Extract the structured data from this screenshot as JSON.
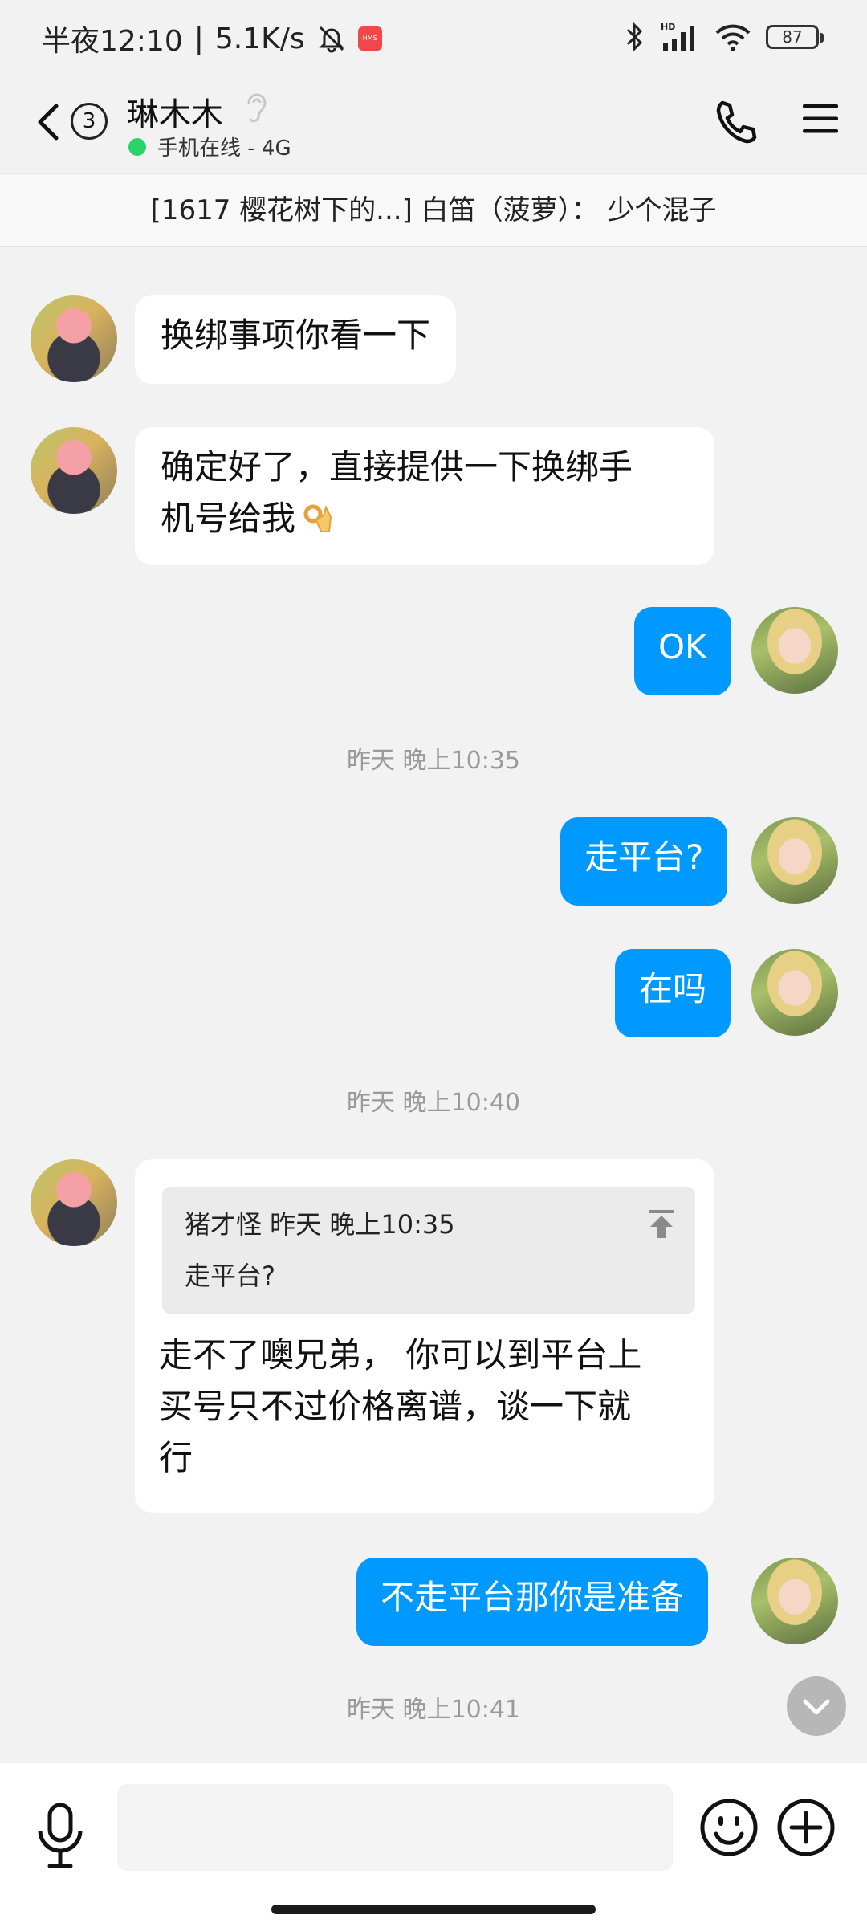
{
  "status_bar": {
    "time": "半夜12:10",
    "net_speed": "5.1K/s",
    "hms_label": "HMS",
    "hd_label": "HD",
    "battery": "87"
  },
  "header": {
    "unread_count": "3",
    "contact_name": "琳木木",
    "online_status": "手机在线 - 4G"
  },
  "pinned": {
    "text": "[1617 樱花树下的...] 白笛（菠萝）： 少个混子"
  },
  "messages": {
    "m1": "换绑事项你看一下",
    "m2_line1": "确定好了，直接提供一下换绑手",
    "m2_line2": "机号给我",
    "m3": "OK",
    "ts1": "昨天 晚上10:35",
    "m4": "走平台?",
    "m5": "在吗",
    "ts2": "昨天 晚上10:40",
    "m6_quote_meta": "猪才怪  昨天 晚上10:35",
    "m6_quote_text": "走平台?",
    "m6_line1": "走不了噢兄弟， 你可以到平台上",
    "m6_line2": "买号只不过价格离谱，谈一下就",
    "m6_line3": "行",
    "m7": "不走平台那你是准备",
    "ts3": "昨天 晚上10:41"
  },
  "input": {
    "placeholder": ""
  },
  "colors": {
    "background": "#f2f2f2",
    "my_bubble": "#0099ff",
    "their_bubble": "#ffffff",
    "online_dot": "#2ad36b"
  }
}
